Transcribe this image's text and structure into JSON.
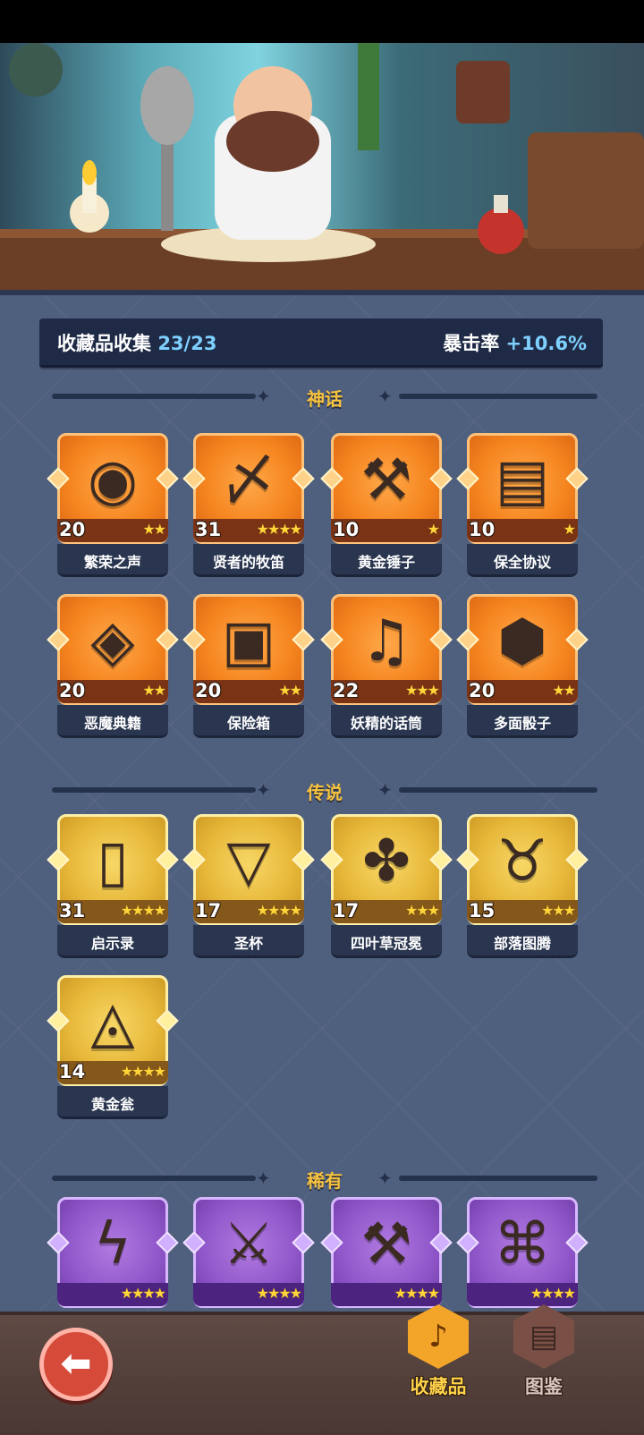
{
  "stats": {
    "collection_label": "收藏品收集",
    "collection_value": "23/23",
    "crit_label": "暴击率",
    "crit_value": "+10.6%"
  },
  "sections": {
    "mythic": "神话",
    "legendary": "传说",
    "rare": "稀有"
  },
  "mythic_items": [
    {
      "name": "繁荣之声",
      "count": "20",
      "stars": "★★",
      "icon": "blue-orb-icon"
    },
    {
      "name": "贤者的牧笛",
      "count": "31",
      "stars": "★★★★",
      "icon": "flute-icon"
    },
    {
      "name": "黄金锤子",
      "count": "10",
      "stars": "★",
      "icon": "hammer-icon"
    },
    {
      "name": "保全协议",
      "count": "10",
      "stars": "★",
      "icon": "contract-icon"
    },
    {
      "name": "恶魔典籍",
      "count": "20",
      "stars": "★★",
      "icon": "demon-book-icon"
    },
    {
      "name": "保险箱",
      "count": "20",
      "stars": "★★",
      "icon": "treasure-chest-icon"
    },
    {
      "name": "妖精的话筒",
      "count": "22",
      "stars": "★★★",
      "icon": "fairy-microphone-icon"
    },
    {
      "name": "多面骰子",
      "count": "20",
      "stars": "★★",
      "icon": "dice-icon"
    }
  ],
  "legendary_items": [
    {
      "name": "启示录",
      "count": "31",
      "stars": "★★★★",
      "icon": "open-book-icon"
    },
    {
      "name": "圣杯",
      "count": "17",
      "stars": "★★★★",
      "icon": "grail-icon"
    },
    {
      "name": "四叶草冠冕",
      "count": "17",
      "stars": "★★★",
      "icon": "clover-crown-icon"
    },
    {
      "name": "部落图腾",
      "count": "15",
      "stars": "★★★",
      "icon": "totem-icon"
    },
    {
      "name": "黄金瓮",
      "count": "14",
      "stars": "★★★★",
      "icon": "golden-urn-icon"
    }
  ],
  "rare_items": [
    {
      "icon": "lightning-card-icon",
      "stars": "★★★★"
    },
    {
      "icon": "ice-sword-icon",
      "stars": "★★★★"
    },
    {
      "icon": "axe-icon",
      "stars": "★★★★"
    },
    {
      "icon": "thorn-vine-icon",
      "stars": "★★★★"
    }
  ],
  "nav": {
    "collection_label": "收藏品",
    "codex_label": "图鉴"
  }
}
